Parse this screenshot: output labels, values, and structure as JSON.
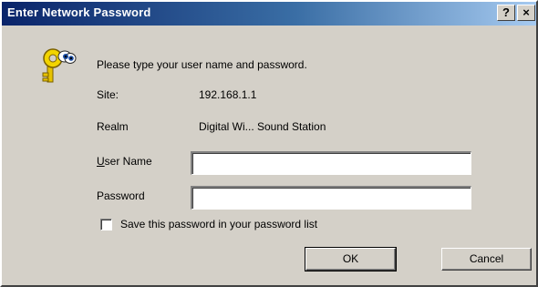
{
  "window": {
    "title": "Enter Network Password",
    "help_label": "?",
    "close_label": "×"
  },
  "dialog": {
    "prompt": "Please type your user name and password.",
    "site_label": "Site:",
    "site_value": "192.168.1.1",
    "realm_label": "Realm",
    "realm_value": "Digital Wi... Sound Station",
    "user_label_mnemonic": "U",
    "user_label_rest": "ser Name",
    "user_value": "",
    "password_label": "Password",
    "password_value": "",
    "save_password_label": "Save this password in your password list",
    "save_password_checked": false,
    "ok_label": "OK",
    "cancel_label": "Cancel"
  },
  "icons": {
    "dialog_icon": "key-with-eyes-icon"
  },
  "colors": {
    "titlebar_start": "#0a246a",
    "titlebar_end": "#a6caf0",
    "dialog_face": "#d4d0c8"
  }
}
